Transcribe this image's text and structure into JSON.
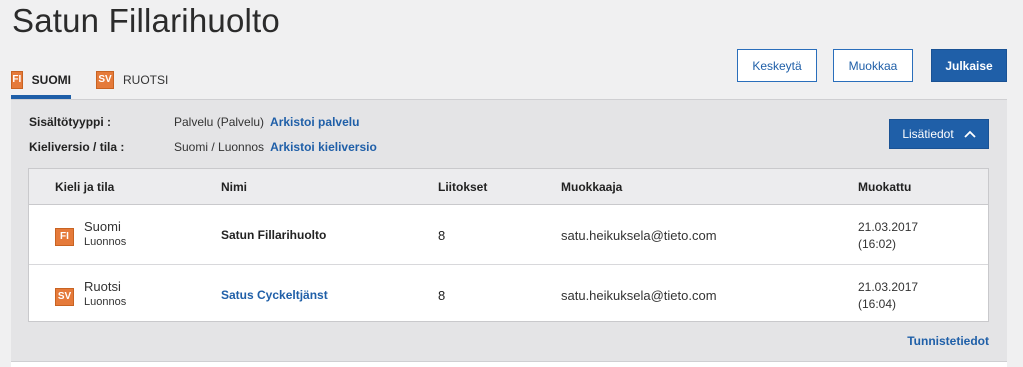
{
  "page": {
    "title": "Satun Fillarihuolto"
  },
  "tabs": [
    {
      "badge": "FI",
      "label": "SUOMI",
      "active": true
    },
    {
      "badge": "SV",
      "label": "RUOTSI",
      "active": false
    }
  ],
  "actions": {
    "cancel": "Keskeytä",
    "edit": "Muokkaa",
    "publish": "Julkaise"
  },
  "meta": {
    "content_type_label": "Sisältötyyppi :",
    "content_type_value": "Palvelu (Palvelu)",
    "archive_service_link": "Arkistoi palvelu",
    "version_label": "Kieliversio / tila :",
    "version_value": "Suomi / Luonnos",
    "archive_version_link": "Arkistoi kieliversio"
  },
  "more_button": "Lisätiedot",
  "table": {
    "headers": [
      "Kieli ja tila",
      "Nimi",
      "Liitokset",
      "Muokkaaja",
      "Muokattu"
    ],
    "rows": [
      {
        "badge": "FI",
        "language": "Suomi",
        "status": "Luonnos",
        "name": "Satun Fillarihuolto",
        "links": "8",
        "editor": "satu.heikuksela@tieto.com",
        "date": "21.03.2017",
        "time": "(16:02)"
      },
      {
        "badge": "SV",
        "language": "Ruotsi",
        "status": "Luonnos",
        "name": "Satus Cyckeltjänst",
        "links": "8",
        "editor": "satu.heikuksela@tieto.com",
        "date": "21.03.2017",
        "time": "(16:04)"
      }
    ]
  },
  "identifiers_link": "Tunnistetiedot",
  "colors": {
    "primary": "#1f5fa8",
    "badge": "#e57a3a",
    "background": "#f0f0f1",
    "panel": "#e4e4e6"
  }
}
